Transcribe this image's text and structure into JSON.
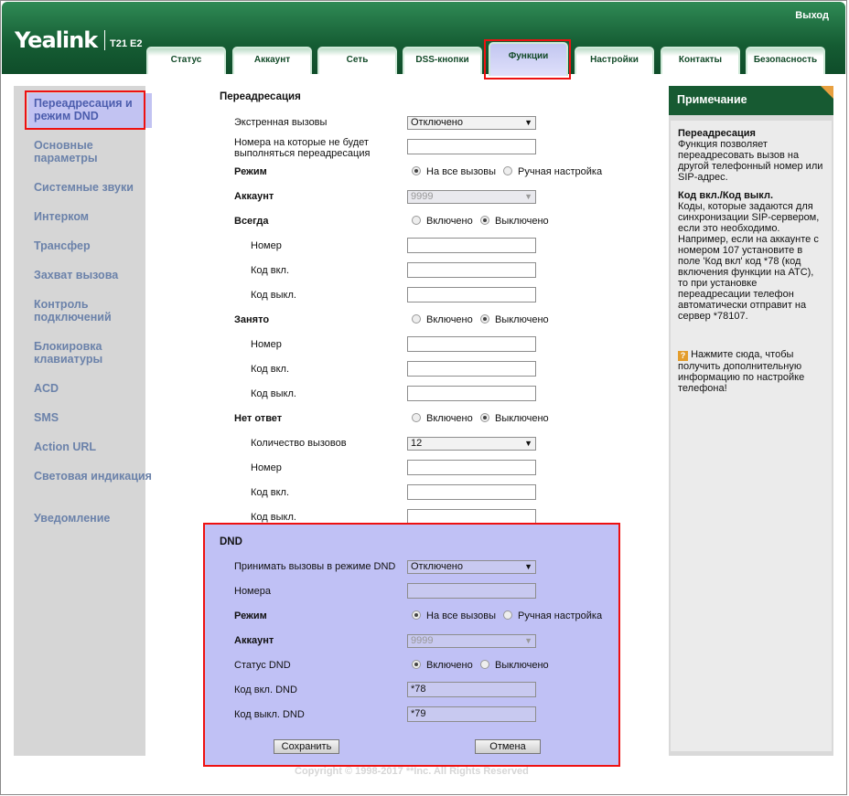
{
  "header": {
    "logo": "Yealink",
    "model": "T21 E2",
    "logout": "Выход",
    "tabs": [
      "Статус",
      "Аккаунт",
      "Сеть",
      "DSS-кнопки",
      "Функции",
      "Настройки",
      "Контакты",
      "Безопасность"
    ],
    "active_tab": "Функции"
  },
  "sidebar": {
    "items": [
      "Переадресация и режим DND",
      "Основные параметры",
      "Системные звуки",
      "Интерком",
      "Трансфер",
      "Захват вызова",
      "Контроль подключений",
      "Блокировка клавиатуры",
      "ACD",
      "SMS",
      "Action URL",
      "Световая индикация",
      "Уведомление"
    ],
    "active": "Переадресация и режим DND"
  },
  "forward": {
    "title": "Переадресация",
    "emergency_label": "Экстренная вызовы",
    "emergency_value": "Отключено",
    "exceptions_label": "Номера на которые не будет выполняться переадресация",
    "exceptions_value": "",
    "mode_label": "Режим",
    "mode_opt1": "На все вызовы",
    "mode_opt2": "Ручная настройка",
    "account_label": "Аккаунт",
    "account_value": "9999",
    "always": {
      "label": "Всегда",
      "on": "Включено",
      "off": "Выключено",
      "number": "Номер",
      "code_on": "Код вкл.",
      "code_off": "Код выкл."
    },
    "busy": {
      "label": "Занято",
      "on": "Включено",
      "off": "Выключено",
      "number": "Номер",
      "code_on": "Код вкл.",
      "code_off": "Код выкл."
    },
    "noanswer": {
      "label": "Нет ответ",
      "on": "Включено",
      "off": "Выключено",
      "rings_label": "Количество вызовов",
      "rings_value": "12",
      "number": "Номер",
      "code_on": "Код вкл.",
      "code_off": "Код выкл."
    }
  },
  "dnd": {
    "title": "DND",
    "accept_label": "Принимать вызовы в режиме DND",
    "accept_value": "Отключено",
    "numbers_label": "Номера",
    "numbers_value": "",
    "mode_label": "Режим",
    "mode_opt1": "На все вызовы",
    "mode_opt2": "Ручная настройка",
    "account_label": "Аккаунт",
    "account_value": "9999",
    "status_label": "Статус DND",
    "status_on": "Включено",
    "status_off": "Выключено",
    "code_on_label": "Код вкл. DND",
    "code_on_value": "*78",
    "code_off_label": "Код выкл. DND",
    "code_off_value": "*79"
  },
  "buttons": {
    "save": "Сохранить",
    "cancel": "Отмена"
  },
  "note": {
    "title": "Примечание",
    "h1": "Переадресация",
    "p1": "Функция позволяет переадресовать вызов на другой телефонный номер или SIP-адрес.",
    "h2": "Код вкл./Код выкл.",
    "p2": "Коды, которые задаются для синхронизации SIP-сервером, если это необходимо. Например, если на аккаунте с номером 107 установите в поле 'Код вкл' код *78 (код включения функции на АТС), то при установке переадресации телефон автоматически отправит на сервер *78107.",
    "help": "Нажмите сюда, чтобы получить дополнительную информацию по настройке телефона!"
  },
  "footer": "Copyright © 1998-2017 **Inc. All Rights Reserved",
  "colors": {
    "brand_green": "#155c33",
    "highlight": "#c0c1f5",
    "accent_red": "#e11111"
  }
}
